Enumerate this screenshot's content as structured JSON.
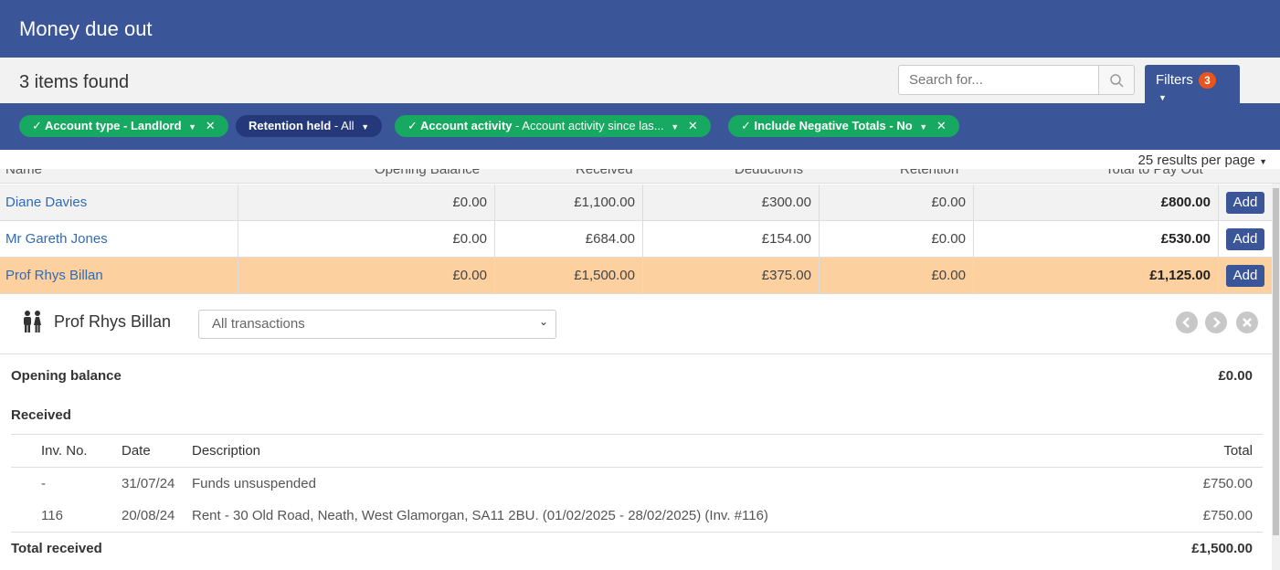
{
  "header": {
    "title": "Money due out"
  },
  "subheader": {
    "items_found": "3 items found"
  },
  "search": {
    "placeholder": "Search for..."
  },
  "filters": {
    "label": "Filters",
    "count": "3"
  },
  "chips": [
    {
      "label": "Account type - Landlord"
    },
    {
      "label_bold": "Retention held",
      "label_rest": " - All"
    },
    {
      "label_bold": "Account activity",
      "label_rest": " - Account activity since las..."
    },
    {
      "label": "Include Negative Totals - No"
    }
  ],
  "pagination": {
    "per_page": "25 results per page"
  },
  "columns": [
    "Name",
    "Opening Balance",
    "Received",
    "Deductions",
    "Retention",
    "Total to Pay Out"
  ],
  "rows": [
    {
      "name": "Diane Davies",
      "opening": "£0.00",
      "received": "£1,100.00",
      "deductions": "£300.00",
      "retention": "£0.00",
      "total": "£800.00",
      "action": "Add"
    },
    {
      "name": "Mr Gareth Jones",
      "opening": "£0.00",
      "received": "£684.00",
      "deductions": "£154.00",
      "retention": "£0.00",
      "total": "£530.00",
      "action": "Add"
    },
    {
      "name": "Prof Rhys Billan",
      "opening": "£0.00",
      "received": "£1,500.00",
      "deductions": "£375.00",
      "retention": "£0.00",
      "total": "£1,125.00",
      "action": "Add"
    }
  ],
  "detail": {
    "person": "Prof Rhys Billan",
    "select_value": "All transactions",
    "opening_label": "Opening balance",
    "opening_value": "£0.00",
    "received_label": "Received",
    "table_headers": {
      "inv": "Inv. No.",
      "date": "Date",
      "description": "Description",
      "total": "Total"
    },
    "transactions": [
      {
        "inv": "-",
        "date": "31/07/24",
        "description": "Funds unsuspended",
        "total": "£750.00"
      },
      {
        "inv": "116",
        "date": "20/08/24",
        "description": "Rent - 30 Old Road, Neath, West Glamorgan, SA11 2BU. (01/02/2025 - 28/02/2025) (Inv. #116)",
        "total": "£750.00"
      }
    ],
    "total_received_label": "Total received",
    "total_received_value": "£1,500.00"
  },
  "colors": {
    "brand": "#3a5698",
    "chip_green": "#17a861",
    "chip_navy": "#24387a",
    "badge": "#e8541e",
    "highlight_row": "#fdd09f",
    "link": "#2f6bb5"
  }
}
